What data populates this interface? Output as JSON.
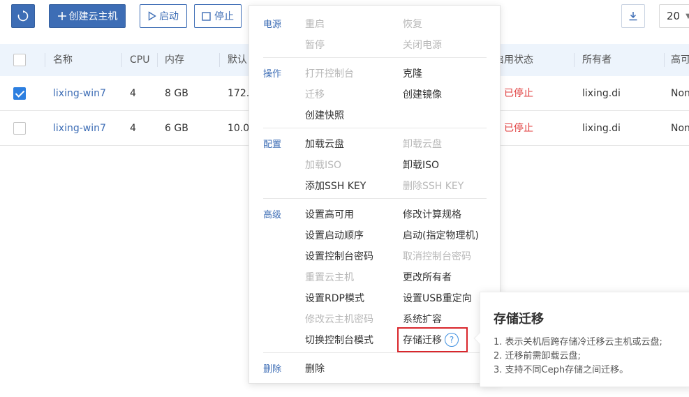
{
  "toolbar": {
    "refresh_icon": "refresh-icon",
    "create_label": "创建云主机",
    "start_label": "启动",
    "stop_label": "停止",
    "download_icon": "download-icon",
    "page_size": "20"
  },
  "table": {
    "columns": [
      "名称",
      "CPU",
      "内存",
      "默认",
      "启用状态",
      "所有者",
      "高可"
    ],
    "rows": [
      {
        "checked": true,
        "name": "lixing-win7",
        "cpu": "4",
        "memory": "8 GB",
        "ip": "172.",
        "status": "已停止",
        "owner": "lixing.di",
        "ha": "Non"
      },
      {
        "checked": false,
        "name": "lixing-win7",
        "cpu": "4",
        "memory": "6 GB",
        "ip": "10.0.",
        "status": "已停止",
        "owner": "lixing.di",
        "ha": "Non"
      }
    ]
  },
  "menu": {
    "power": {
      "label": "电源",
      "items": [
        {
          "label": "重启",
          "disabled": true
        },
        {
          "label": "恢复",
          "disabled": true
        },
        {
          "label": "暂停",
          "disabled": true
        },
        {
          "label": "关闭电源",
          "disabled": true
        }
      ]
    },
    "ops": {
      "label": "操作",
      "items": [
        {
          "label": "打开控制台",
          "disabled": true
        },
        {
          "label": "克隆",
          "disabled": false
        },
        {
          "label": "迁移",
          "disabled": true
        },
        {
          "label": "创建镜像",
          "disabled": false
        },
        {
          "label": "创建快照",
          "disabled": false
        }
      ]
    },
    "config": {
      "label": "配置",
      "items": [
        {
          "label": "加载云盘",
          "disabled": false
        },
        {
          "label": "卸载云盘",
          "disabled": true
        },
        {
          "label": "加载ISO",
          "disabled": true
        },
        {
          "label": "卸载ISO",
          "disabled": false
        },
        {
          "label": "添加SSH KEY",
          "disabled": false
        },
        {
          "label": "删除SSH KEY",
          "disabled": true
        }
      ]
    },
    "advanced": {
      "label": "高级",
      "items": [
        {
          "label": "设置高可用",
          "disabled": false
        },
        {
          "label": "修改计算规格",
          "disabled": false
        },
        {
          "label": "设置启动顺序",
          "disabled": false
        },
        {
          "label": "启动(指定物理机)",
          "disabled": false
        },
        {
          "label": "设置控制台密码",
          "disabled": false
        },
        {
          "label": "取消控制台密码",
          "disabled": true
        },
        {
          "label": "重置云主机",
          "disabled": true
        },
        {
          "label": "更改所有者",
          "disabled": false
        },
        {
          "label": "设置RDP模式",
          "disabled": false
        },
        {
          "label": "设置USB重定向",
          "disabled": false
        },
        {
          "label": "修改云主机密码",
          "disabled": true
        },
        {
          "label": "系统扩容",
          "disabled": false
        },
        {
          "label": "切换控制台模式",
          "disabled": false
        },
        {
          "label": "存储迁移",
          "disabled": false
        }
      ]
    },
    "delete": {
      "label": "删除",
      "items": [
        {
          "label": "删除",
          "disabled": false
        }
      ]
    },
    "help_icon_glyph": "?"
  },
  "tooltip": {
    "title": "存储迁移",
    "lines": [
      "1. 表示关机后跨存储冷迁移云主机或云盘;",
      "2. 迁移前需卸载云盘;",
      "3. 支持不同Ceph存储之间迁移。"
    ]
  },
  "colors": {
    "primary": "#3d6db5",
    "header_bg": "#edf4fc",
    "checkbox_checked": "#2d7fe0",
    "stopped": "#e03c3c",
    "highlight_border": "#d9262c"
  }
}
